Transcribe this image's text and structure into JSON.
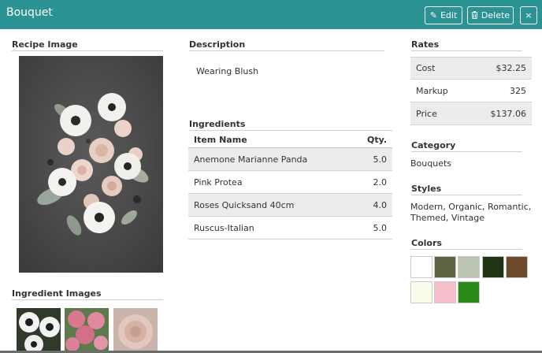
{
  "header": {
    "title": "Bouquet",
    "edit_label": "Edit",
    "delete_label": "Delete",
    "close_label": "×"
  },
  "recipe_image": {
    "heading": "Recipe Image"
  },
  "ingredient_images": {
    "heading": "Ingredient Images"
  },
  "description": {
    "heading": "Description",
    "text": "Wearing Blush"
  },
  "ingredients": {
    "heading": "Ingredients",
    "columns": [
      "Item Name",
      "Qty."
    ],
    "rows": [
      {
        "name": "Anemone Marianne Panda",
        "qty": "5.0"
      },
      {
        "name": "Pink Protea",
        "qty": "2.0"
      },
      {
        "name": "Roses Quicksand 40cm",
        "qty": "4.0"
      },
      {
        "name": "Ruscus-Italian",
        "qty": "5.0"
      }
    ]
  },
  "rates": {
    "heading": "Rates",
    "rows": [
      {
        "label": "Cost",
        "value": "$32.25"
      },
      {
        "label": "Markup",
        "value": "325"
      },
      {
        "label": "Price",
        "value": "$137.06"
      }
    ]
  },
  "category": {
    "heading": "Category",
    "value": "Bouquets"
  },
  "styles": {
    "heading": "Styles",
    "line1": "Modern, Organic, Romantic,",
    "line2": "Themed, Vintage"
  },
  "colors": {
    "heading": "Colors",
    "swatches": [
      "#ffffff",
      "#5f6342",
      "#bcc5b4",
      "#1f3413",
      "#6d4a2c",
      "#fcfcec",
      "#f6bfcc",
      "#2c8a19"
    ]
  },
  "theme": {
    "header_bg": "#2b9393",
    "row_alt": "#ececec"
  }
}
